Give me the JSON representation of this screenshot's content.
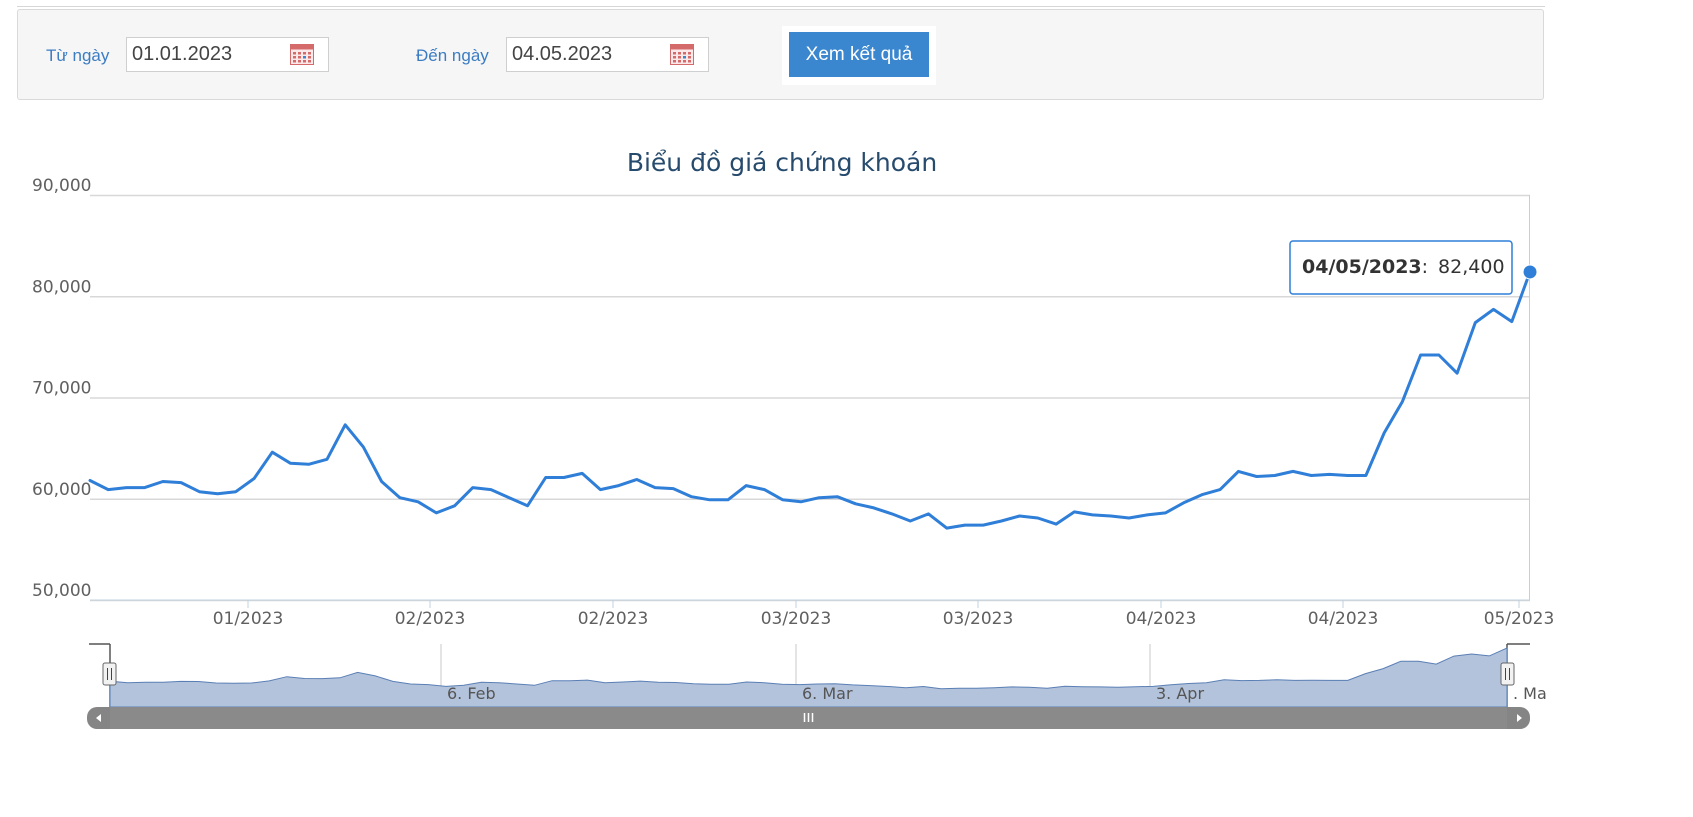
{
  "filters": {
    "from_label": "Từ ngày",
    "from_value": "01.01.2023",
    "to_label": "Đến ngày",
    "to_value": "04.05.2023",
    "submit_label": "Xem kết quả"
  },
  "colors": {
    "line": "#2f7ed8",
    "navigator_fill": "#b3c3db",
    "accent": "#3a87cf"
  },
  "chart_data": {
    "type": "line",
    "title": "Biểu đồ giá chứng khoán",
    "ylim": [
      50000,
      90000
    ],
    "yticks": [
      50000,
      60000,
      70000,
      80000,
      90000
    ],
    "ytick_labels": [
      "50,000",
      "60,000",
      "70,000",
      "80,000",
      "90,000"
    ],
    "xtick_labels": [
      "01/2023",
      "02/2023",
      "02/2023",
      "03/2023",
      "03/2023",
      "04/2023",
      "04/2023",
      "05/2023"
    ],
    "grid": true,
    "series": [
      {
        "values": [
          61800,
          60900,
          61100,
          61100,
          61700,
          61600,
          60700,
          60500,
          60700,
          62000,
          64600,
          63500,
          63400,
          63900,
          67300,
          65100,
          61700,
          60100,
          59700,
          58600,
          59300,
          61100,
          60900,
          60100,
          59300,
          62100,
          62100,
          62500,
          60900,
          61300,
          61900,
          61100,
          61000,
          60200,
          59900,
          59900,
          61300,
          60900,
          59900,
          59700,
          60100,
          60200,
          59500,
          59100,
          58500,
          57800,
          58500,
          57100,
          57400,
          57400,
          57800,
          58300,
          58100,
          57500,
          58700,
          58400,
          58300,
          58100,
          58400,
          58600,
          59600,
          60400,
          60900,
          62700,
          62200,
          62300,
          62700,
          62300,
          62400,
          62300,
          62300,
          66500,
          69600,
          74200,
          74200,
          72400,
          77400,
          78700,
          77500,
          82400
        ]
      }
    ],
    "tooltip": {
      "date": "04/05/2023",
      "separator": ":",
      "value": "82,400"
    },
    "navigator": {
      "labels": [
        "6. Feb",
        "6. Mar",
        "3. Apr",
        ". Ma"
      ]
    }
  }
}
